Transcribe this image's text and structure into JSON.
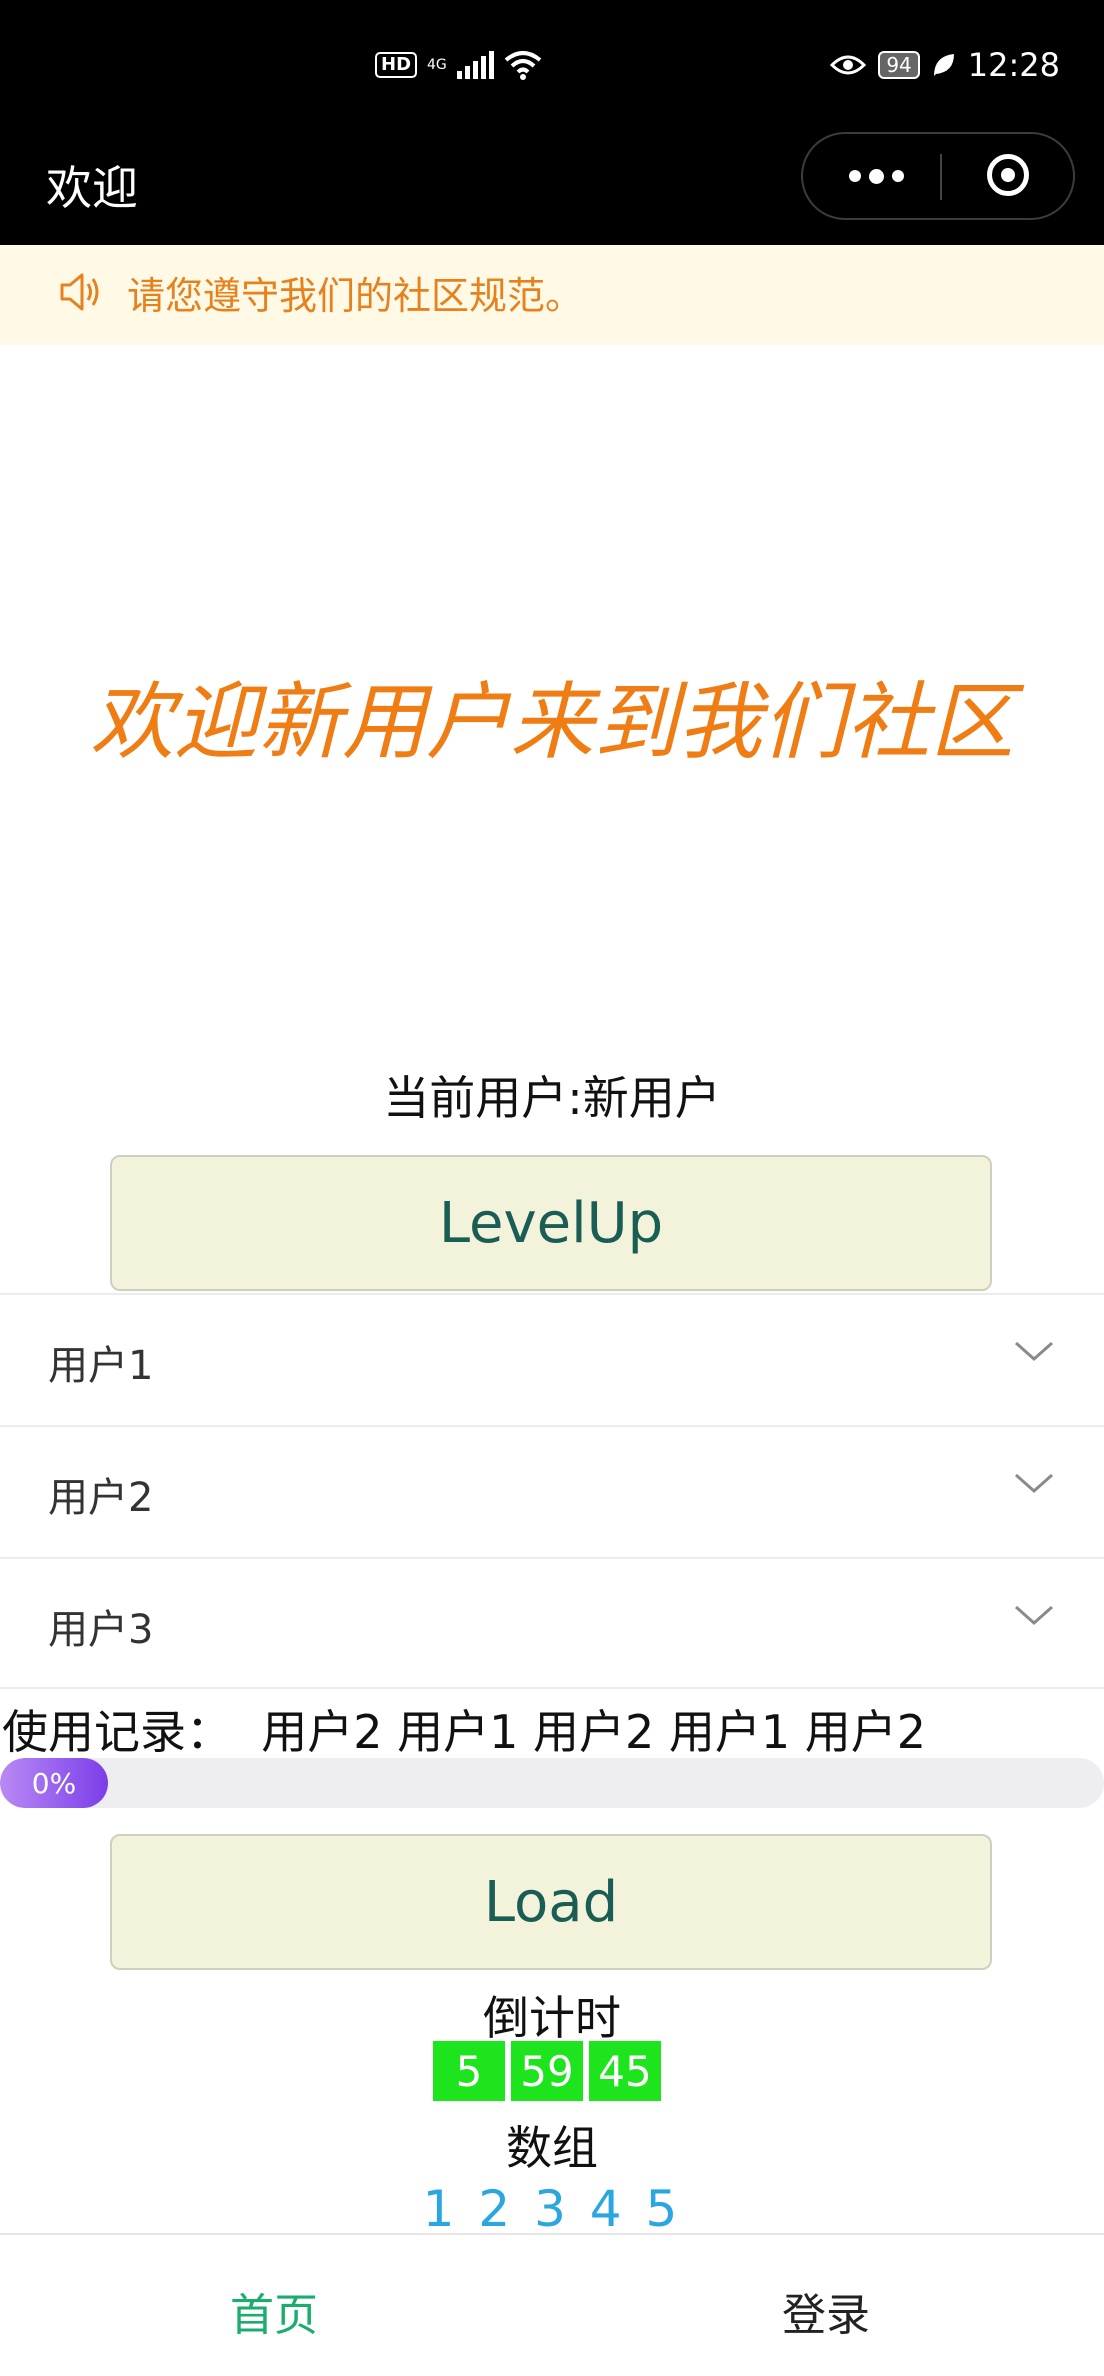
{
  "status_bar": {
    "hd": "HD",
    "network": "4G",
    "battery": "94",
    "time": "12:28"
  },
  "nav": {
    "title": "欢迎"
  },
  "notice": {
    "text": "请您遵守我们的社区规范。"
  },
  "headline": "欢迎新用户来到我们社区",
  "current_user": "当前用户:新用户",
  "buttons": {
    "levelup": "LevelUp",
    "load": "Load"
  },
  "collapse_items": [
    {
      "label": "用户1"
    },
    {
      "label": "用户2"
    },
    {
      "label": "用户3"
    }
  ],
  "history": "使用记录：  用户2 用户1 用户2 用户1 用户2",
  "progress": {
    "label": "0%",
    "value": 0
  },
  "countdown": {
    "label": "倒计时",
    "values": [
      "5",
      "59",
      "45"
    ],
    "color": "#1ee41e"
  },
  "array": {
    "label": "数组",
    "values": "1 2 3 4 5"
  },
  "tabs": [
    {
      "label": "首页",
      "active": true,
      "color": "#1aad6e"
    },
    {
      "label": "登录",
      "active": false
    }
  ],
  "colors": {
    "headline": "#f07c14",
    "notice_text": "#e6821e",
    "button_bg": "#f3f2da",
    "button_text": "#1a5d55"
  }
}
